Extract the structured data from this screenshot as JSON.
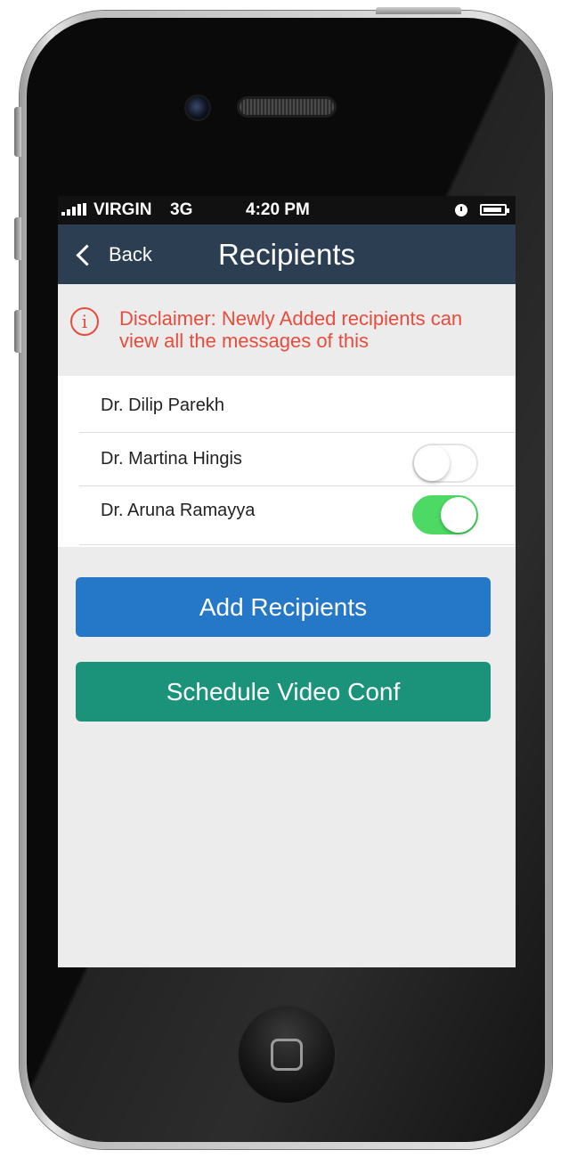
{
  "status_bar": {
    "carrier": "VIRGIN",
    "network": "3G",
    "time": "4:20 PM"
  },
  "nav": {
    "back_label": "Back",
    "title": "Recipients"
  },
  "disclaimer": {
    "icon": "info-icon",
    "text": "Disclaimer: Newly Added recipients can view all the messages of this",
    "color": "#e74c3c"
  },
  "recipients": [
    {
      "name": "Dr. Dilip Parekh",
      "toggle": null
    },
    {
      "name": "Dr. Martina Hingis",
      "toggle": "off"
    },
    {
      "name": "Dr. Aruna Ramayya",
      "toggle": "on"
    }
  ],
  "buttons": {
    "add_label": "Add Recipients",
    "schedule_label": "Schedule Video Conf"
  },
  "colors": {
    "nav_bar": "#2c3e52",
    "add_button": "#2577c8",
    "schedule_button": "#1a937a",
    "toggle_on": "#4cd964"
  }
}
